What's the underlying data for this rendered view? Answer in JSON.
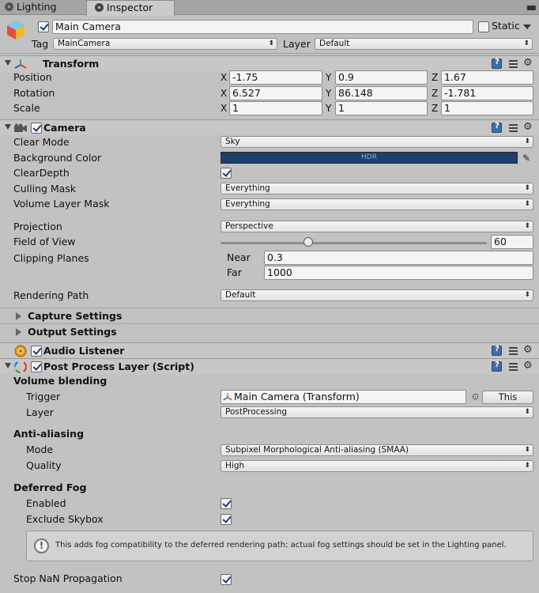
{
  "tabs": [
    {
      "label": "Lighting"
    },
    {
      "label": "Inspector"
    }
  ],
  "header": {
    "object_name": "Main Camera",
    "static_label": "Static",
    "tag_label": "Tag",
    "tag_value": "MainCamera",
    "layer_label": "Layer",
    "layer_value": "Default"
  },
  "transform": {
    "title": "Transform",
    "rows": [
      {
        "label": "Position",
        "x": "-1.75",
        "y": "0.9",
        "z": "1.67"
      },
      {
        "label": "Rotation",
        "x": "6.527",
        "y": "86.148",
        "z": "-1.781"
      },
      {
        "label": "Scale",
        "x": "1",
        "y": "1",
        "z": "1"
      }
    ],
    "axis": {
      "x": "X",
      "y": "Y",
      "z": "Z"
    }
  },
  "camera": {
    "title": "Camera",
    "clear_mode_label": "Clear Mode",
    "clear_mode_value": "Sky",
    "background_color_label": "Background Color",
    "hdr_text": "HDR",
    "background_color": "#1e3f6d",
    "clear_depth_label": "ClearDepth",
    "culling_mask_label": "Culling Mask",
    "culling_mask_value": "Everything",
    "volume_layer_mask_label": "Volume Layer Mask",
    "volume_layer_mask_value": "Everything",
    "projection_label": "Projection",
    "projection_value": "Perspective",
    "fov_label": "Field of View",
    "fov_value": "60",
    "fov_fraction": 0.33,
    "clipping_label": "Clipping Planes",
    "near_label": "Near",
    "near_value": "0.3",
    "far_label": "Far",
    "far_value": "1000",
    "rendering_path_label": "Rendering Path",
    "rendering_path_value": "Default",
    "capture_settings": "Capture Settings",
    "output_settings": "Output Settings"
  },
  "audio_listener": {
    "title": "Audio Listener"
  },
  "ppl": {
    "title": "Post Process Layer (Script)",
    "volume_blending": "Volume blending",
    "trigger_label": "Trigger",
    "trigger_value": "Main Camera (Transform)",
    "this_button": "This",
    "layer_label": "Layer",
    "layer_value": "PostProcessing",
    "anti_aliasing": "Anti-aliasing",
    "mode_label": "Mode",
    "mode_value": "Subpixel Morphological Anti-aliasing (SMAA)",
    "quality_label": "Quality",
    "quality_value": "High",
    "deferred_fog": "Deferred Fog",
    "enabled_label": "Enabled",
    "exclude_skybox_label": "Exclude Skybox",
    "help_text": "This adds fog compatibility to the deferred rendering path; actual fog settings should be set in the Lighting panel.",
    "stop_nan_label": "Stop NaN Propagation"
  }
}
